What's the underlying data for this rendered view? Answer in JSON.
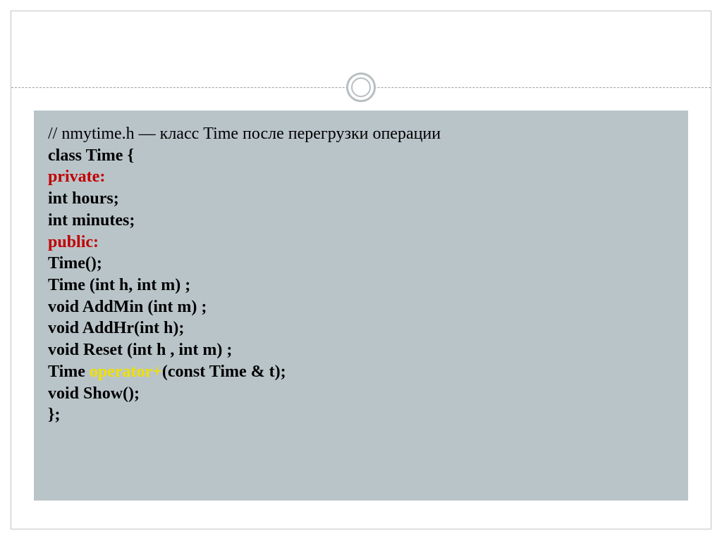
{
  "code": {
    "line1": "// nmytime.h — класс Time после перегрузки операции",
    "line2": "class Time {",
    "line3": "private:",
    "line4": "int hours;",
    "line5": "int minutes;",
    "line6": "public:",
    "line7": "Time();",
    "line8": "Time (int h, int m) ;",
    "line9": "void AddMin (int m) ;",
    "line10": "void AddHr(int h);",
    "line11": "void Reset (int h , int m) ;",
    "line12_a": "Time ",
    "line12_b": "operator+",
    "line12_c": "(const Time & t);",
    "line13": "void Show();",
    "line14": "};"
  }
}
